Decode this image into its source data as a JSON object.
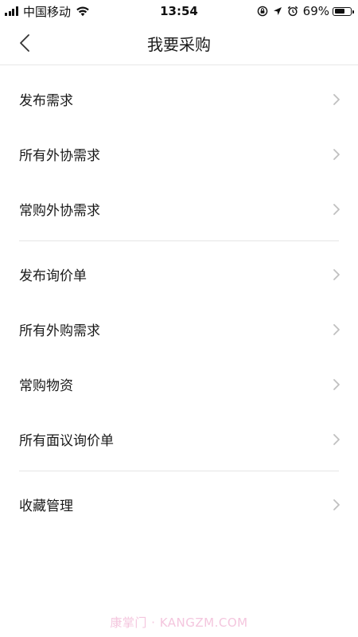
{
  "status_bar": {
    "carrier": "中国移动",
    "time": "13:54",
    "battery_percent": "69%",
    "battery_level": 0.69
  },
  "nav": {
    "title": "我要采购"
  },
  "groups": [
    {
      "items": [
        {
          "label": "发布需求"
        },
        {
          "label": "所有外协需求"
        },
        {
          "label": "常购外协需求"
        }
      ]
    },
    {
      "items": [
        {
          "label": "发布询价单"
        },
        {
          "label": "所有外购需求"
        },
        {
          "label": "常购物资"
        },
        {
          "label": "所有面议询价单"
        }
      ]
    },
    {
      "items": [
        {
          "label": "收藏管理"
        }
      ]
    }
  ],
  "watermark": "康掌门 · KANGZM.COM",
  "colors": {
    "text": "#1a1a1a",
    "divider": "#e6e6e6",
    "chevron": "#c0c0c0",
    "watermark": "#f4c6de"
  }
}
